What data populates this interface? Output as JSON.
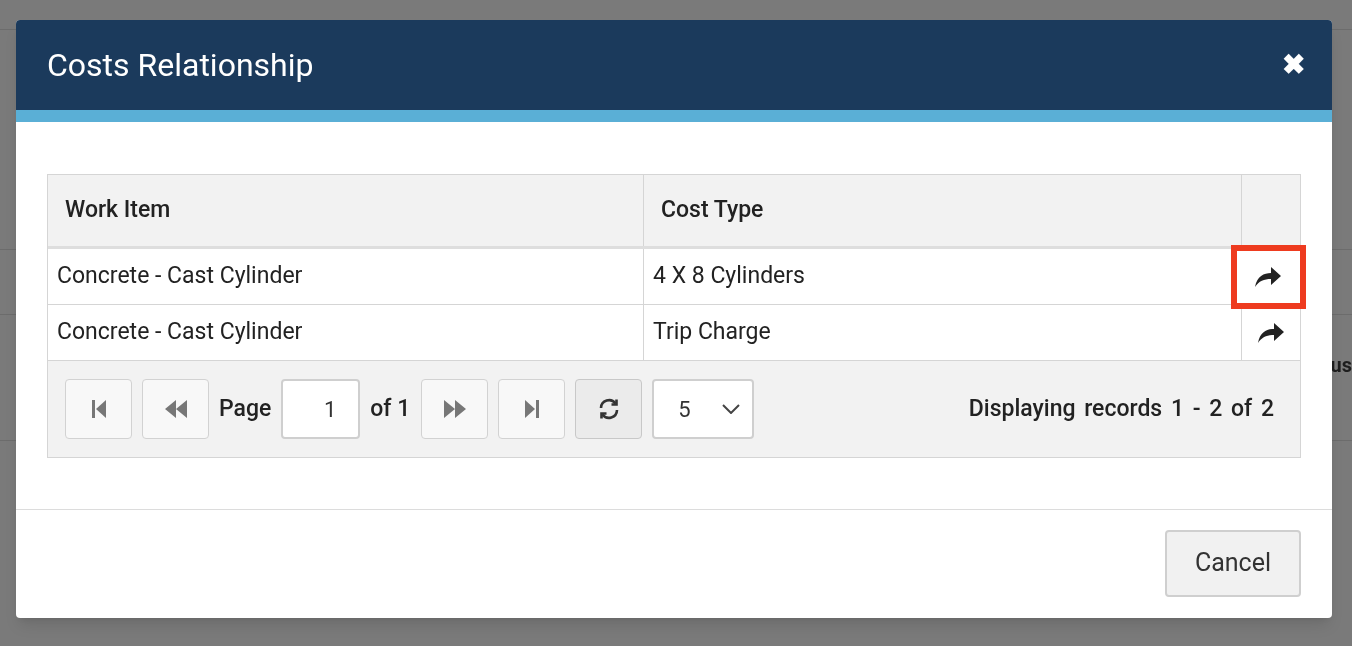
{
  "background": {
    "text": "us"
  },
  "dialog": {
    "title": "Costs Relationship",
    "close": "✖",
    "table": {
      "columns": [
        "Work Item",
        "Cost Type"
      ],
      "rows": [
        {
          "work_item": "Concrete - Cast Cylinder",
          "cost_type": "4 X 8 Cylinders",
          "highlighted": true
        },
        {
          "work_item": "Concrete - Cast Cylinder",
          "cost_type": "Trip Charge",
          "highlighted": false
        }
      ]
    },
    "pager": {
      "first_disabled": true,
      "prev_disabled": true,
      "next_disabled": true,
      "last_disabled": true,
      "page_label": "Page",
      "page": "1",
      "of_label": "of 1",
      "page_size": "5",
      "summary": "Displaying records 1 - 2 of 2"
    },
    "buttons": [
      "Cancel"
    ]
  }
}
